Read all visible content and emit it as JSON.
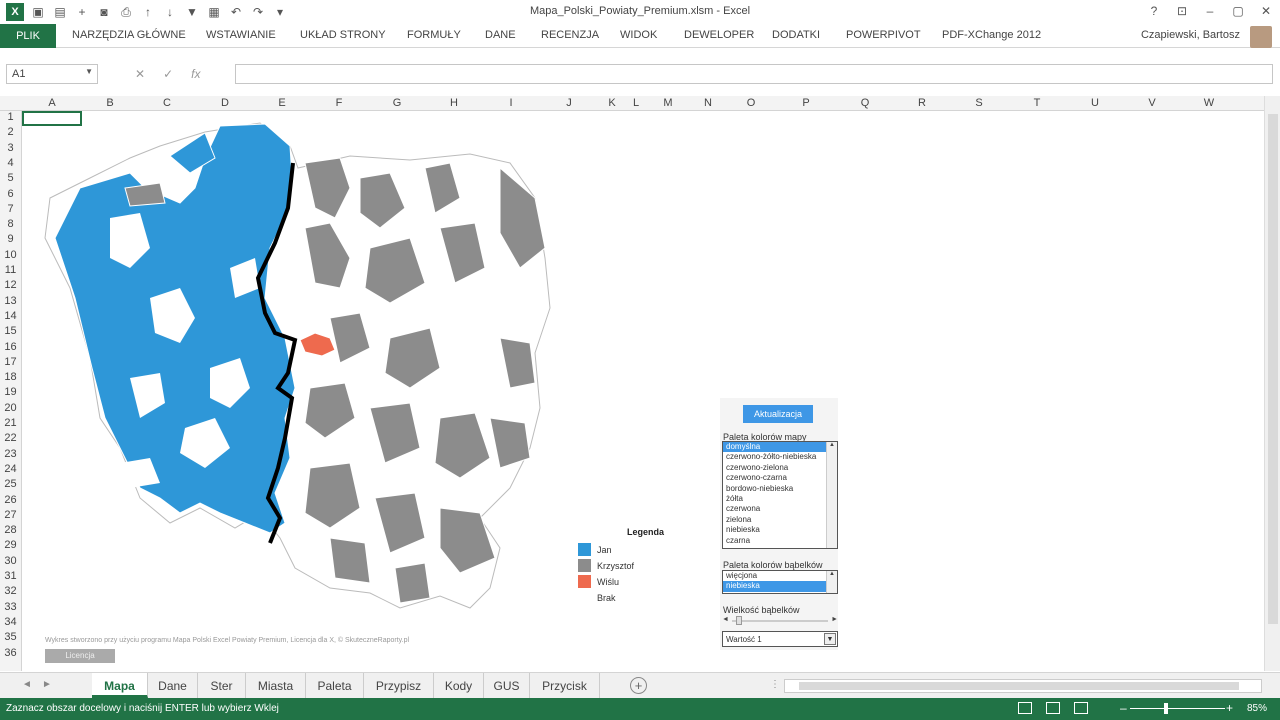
{
  "window": {
    "title": "Mapa_Polski_Powiaty_Premium.xlsm - Excel",
    "help_icon": "?",
    "controls": [
      "restore-ribbon",
      "minimize",
      "maximize",
      "close"
    ]
  },
  "ribbon": {
    "file_tab": "PLIK",
    "tabs": [
      "NARZĘDZIA GŁÓWNE",
      "WSTAWIANIE",
      "UKŁAD STRONY",
      "FORMUŁY",
      "DANE",
      "RECENZJA",
      "WIDOK",
      "DEWELOPER",
      "DODATKI",
      "POWERPIVOT",
      "PDF-XChange 2012"
    ],
    "user": "Czapiewski, Bartosz"
  },
  "formula_bar": {
    "name_box": "A1",
    "formula": ""
  },
  "columns": [
    "A",
    "B",
    "C",
    "D",
    "E",
    "F",
    "G",
    "H",
    "I",
    "J",
    "K",
    "L",
    "M",
    "N",
    "O",
    "P",
    "Q",
    "R",
    "S",
    "T",
    "U",
    "V",
    "W"
  ],
  "rows": [
    "1",
    "2",
    "3",
    "4",
    "5",
    "6",
    "7",
    "8",
    "9",
    "10",
    "11",
    "12",
    "13",
    "14",
    "15",
    "16",
    "17",
    "18",
    "19",
    "20",
    "21",
    "22",
    "23",
    "24",
    "25",
    "26",
    "27",
    "28",
    "29",
    "30",
    "31",
    "32",
    "33",
    "34",
    "35",
    "36"
  ],
  "map": {
    "legend_title": "Legenda",
    "legend": [
      {
        "label": "Jan",
        "color": "#2e97d8"
      },
      {
        "label": "Krzysztof",
        "color": "#8c8c8c"
      },
      {
        "label": "Wiślu",
        "color": "#ee6a4e"
      },
      {
        "label": "Brak",
        "color": "#ffffff"
      }
    ],
    "credit": "Wykres stworzono przy użyciu programu Mapa Polski Excel Powiaty Premium, Licencja dla X, © SkuteczneRaporty.pl",
    "license_button": "Licencja"
  },
  "panel": {
    "update_button": "Aktualizacja",
    "map_palette_label": "Paleta kolorów mapy",
    "map_palette_options": [
      "domyślna",
      "czerwono-żółto-niebieska",
      "czerwono-zielona",
      "czerwono-czarna",
      "bordowo-niebieska",
      "żółta",
      "czerwona",
      "zielona",
      "niebieska",
      "czarna"
    ],
    "map_palette_selected": 0,
    "bubble_palette_label": "Paleta kolorów bąbelków",
    "bubble_palette_options": [
      "więcjona",
      "niebieska"
    ],
    "bubble_palette_selected": 1,
    "bubble_size_label": "Wielkość bąbelków",
    "value_select": "Wartość 1"
  },
  "sheets": [
    "Mapa",
    "Dane",
    "Ster",
    "Miasta",
    "Paleta",
    "Przypisz",
    "Kody",
    "GUS",
    "Przycisk"
  ],
  "active_sheet": "Mapa",
  "status": {
    "message": "Zaznacz obszar docelowy i naciśnij ENTER lub wybierz Wklej",
    "zoom": "85%"
  }
}
